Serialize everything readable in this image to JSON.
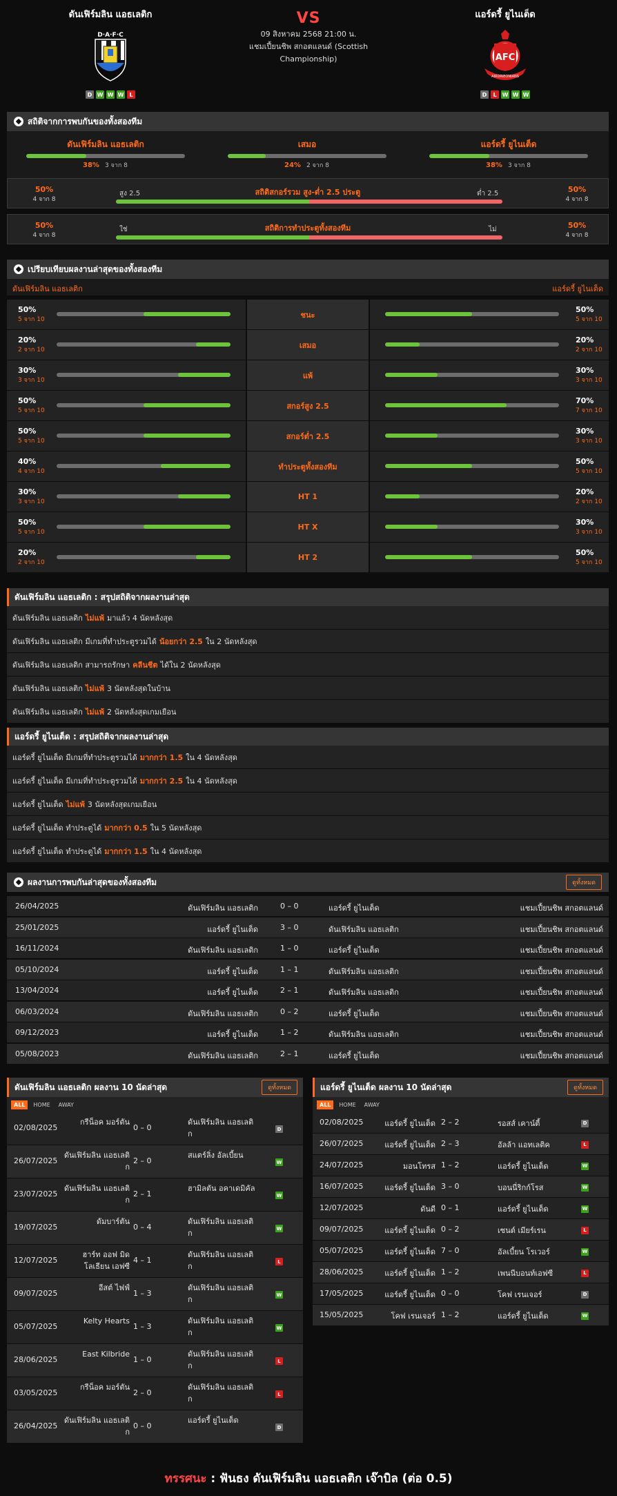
{
  "header": {
    "home": {
      "name": "ดันเฟิร์มลิน แอธเลติก",
      "logo_text": "D·A·F·C",
      "form": [
        "D",
        "W",
        "W",
        "W",
        "L"
      ]
    },
    "away": {
      "name": "แอร์ดรี้ ยูไนเต็ด",
      "logo_text": "AFC",
      "logo_ribbon": "AIRDRIEONIANS",
      "form": [
        "D",
        "L",
        "W",
        "W",
        "W"
      ]
    },
    "vs": "VS",
    "date": "09 สิงหาคม 2568 21:00 น.",
    "competition": "แชมเปี้ยนชิพ สกอตแลนด์ (Scottish Championship)"
  },
  "h2h_stats": {
    "title": "สถิติจากการพบกันของทั้งสองทีม",
    "cols": [
      {
        "label": "ดันเฟิร์มลิน แอธเลติก",
        "pct": "38%",
        "detail": "3 จาก 8",
        "value": 0.38
      },
      {
        "label": "เสมอ",
        "pct": "24%",
        "detail": "2 จาก 8",
        "value": 0.24
      },
      {
        "label": "แอร์ดรี้ ยูไนเต็ด",
        "pct": "38%",
        "detail": "3 จาก 8",
        "value": 0.38
      }
    ],
    "over_under": {
      "title": "สถิติสกอร์รวม สูง-ต่ำ 2.5 ประตู",
      "left_pct": "50%",
      "left_detail": "4 จาก 8",
      "left_label": "สูง 2.5",
      "right_label": "ต่ำ 2.5",
      "right_pct": "50%",
      "right_detail": "4 จาก 8",
      "value": 0.5
    },
    "btts": {
      "title": "สถิติการทำประตูทั้งสองทีม",
      "left_pct": "50%",
      "left_detail": "4 จาก 8",
      "left_label": "ใช่",
      "right_label": "ไม่",
      "right_pct": "50%",
      "right_detail": "4 จาก 8",
      "value": 0.5
    }
  },
  "recent_compare": {
    "title": "เปรียบเทียบผลงานล่าสุดของทั้งสองทีม",
    "home_label": "ดันเฟิร์มลิน แอธเลติก",
    "away_label": "แอร์ดรี้ ยูไนเต็ด",
    "rows": [
      {
        "label": "ชนะ",
        "home_pct": "50%",
        "home_detail": "5 จาก 10",
        "home_value": 0.5,
        "away_pct": "50%",
        "away_detail": "5 จาก 10",
        "away_value": 0.5
      },
      {
        "label": "เสมอ",
        "home_pct": "20%",
        "home_detail": "2 จาก 10",
        "home_value": 0.2,
        "away_pct": "20%",
        "away_detail": "2 จาก 10",
        "away_value": 0.2
      },
      {
        "label": "แพ้",
        "home_pct": "30%",
        "home_detail": "3 จาก 10",
        "home_value": 0.3,
        "away_pct": "30%",
        "away_detail": "3 จาก 10",
        "away_value": 0.3
      },
      {
        "label": "สกอร์สูง 2.5",
        "home_pct": "50%",
        "home_detail": "5 จาก 10",
        "home_value": 0.5,
        "away_pct": "70%",
        "away_detail": "7 จาก 10",
        "away_value": 0.7
      },
      {
        "label": "สกอร์ต่ำ 2.5",
        "home_pct": "50%",
        "home_detail": "5 จาก 10",
        "home_value": 0.5,
        "away_pct": "30%",
        "away_detail": "3 จาก 10",
        "away_value": 0.3
      },
      {
        "label": "ทำประตูทั้งสองทีม",
        "home_pct": "40%",
        "home_detail": "4 จาก 10",
        "home_value": 0.4,
        "away_pct": "50%",
        "away_detail": "5 จาก 10",
        "away_value": 0.5
      },
      {
        "label": "HT 1",
        "home_pct": "30%",
        "home_detail": "3 จาก 10",
        "home_value": 0.3,
        "away_pct": "20%",
        "away_detail": "2 จาก 10",
        "away_value": 0.2
      },
      {
        "label": "HT X",
        "home_pct": "50%",
        "home_detail": "5 จาก 10",
        "home_value": 0.5,
        "away_pct": "30%",
        "away_detail": "3 จาก 10",
        "away_value": 0.3
      },
      {
        "label": "HT 2",
        "home_pct": "20%",
        "home_detail": "2 จาก 10",
        "home_value": 0.2,
        "away_pct": "50%",
        "away_detail": "5 จาก 10",
        "away_value": 0.5
      }
    ]
  },
  "home_summary": {
    "title": "ดันเฟิร์มลิน แอธเลติก : สรุปสถิติจากผลงานล่าสุด",
    "rows": [
      {
        "pre": "ดันเฟิร์มลิน แอธเลติก",
        "hl": "ไม่แพ้",
        "post": "มาแล้ว 4 นัดหลังสุด"
      },
      {
        "pre": "ดันเฟิร์มลิน แอธเลติก มีเกมที่ทำประตูรวมได้",
        "hl": "น้อยกว่า 2.5",
        "post": "ใน 2 นัดหลังสุด"
      },
      {
        "pre": "ดันเฟิร์มลิน แอธเลติก สามารถรักษา",
        "hl": "คลีนชีต",
        "post": "ได้ใน 2 นัดหลังสุด"
      },
      {
        "pre": "ดันเฟิร์มลิน แอธเลติก",
        "hl": "ไม่แพ้",
        "post": "3 นัดหลังสุดในบ้าน"
      },
      {
        "pre": "ดันเฟิร์มลิน แอธเลติก",
        "hl": "ไม่แพ้",
        "post": "2 นัดหลังสุดเกมเยือน"
      }
    ]
  },
  "away_summary": {
    "title": "แอร์ดรี้ ยูไนเต็ด : สรุปสถิติจากผลงานล่าสุด",
    "rows": [
      {
        "pre": "แอร์ดรี้ ยูไนเต็ด มีเกมที่ทำประตูรวมได้",
        "hl": "มากกว่า 1.5",
        "post": "ใน 4 นัดหลังสุด"
      },
      {
        "pre": "แอร์ดรี้ ยูไนเต็ด มีเกมที่ทำประตูรวมได้",
        "hl": "มากกว่า 2.5",
        "post": "ใน 4 นัดหลังสุด"
      },
      {
        "pre": "แอร์ดรี้ ยูไนเต็ด",
        "hl": "ไม่แพ้",
        "post": "3 นัดหลังสุดเกมเยือน"
      },
      {
        "pre": "แอร์ดรี้ ยูไนเต็ด ทำประตูได้",
        "hl": "มากกว่า 0.5",
        "post": "ใน 5 นัดหลังสุด"
      },
      {
        "pre": "แอร์ดรี้ ยูไนเต็ด ทำประตูได้",
        "hl": "มากกว่า 1.5",
        "post": "ใน 4 นัดหลังสุด"
      }
    ]
  },
  "h2h_matches": {
    "title": "ผลงานการพบกันล่าสุดของทั้งสองทีม",
    "see_all": "ดูทั้งหมด",
    "rows": [
      {
        "date": "26/04/2025",
        "home": "ดันเฟิร์มลิน แอธเลติก",
        "score": "0 – 0",
        "away": "แอร์ดรี้ ยูไนเต็ด",
        "league": "แชมเปี้ยนชิพ สกอตแลนด์"
      },
      {
        "date": "25/01/2025",
        "home": "แอร์ดรี้ ยูไนเต็ด",
        "score": "3 – 0",
        "away": "ดันเฟิร์มลิน แอธเลติก",
        "league": "แชมเปี้ยนชิพ สกอตแลนด์"
      },
      {
        "date": "16/11/2024",
        "home": "ดันเฟิร์มลิน แอธเลติก",
        "score": "1 – 0",
        "away": "แอร์ดรี้ ยูไนเต็ด",
        "league": "แชมเปี้ยนชิพ สกอตแลนด์"
      },
      {
        "date": "05/10/2024",
        "home": "แอร์ดรี้ ยูไนเต็ด",
        "score": "1 – 1",
        "away": "ดันเฟิร์มลิน แอธเลติก",
        "league": "แชมเปี้ยนชิพ สกอตแลนด์"
      },
      {
        "date": "13/04/2024",
        "home": "แอร์ดรี้ ยูไนเต็ด",
        "score": "2 – 1",
        "away": "ดันเฟิร์มลิน แอธเลติก",
        "league": "แชมเปี้ยนชิพ สกอตแลนด์"
      },
      {
        "date": "06/03/2024",
        "home": "ดันเฟิร์มลิน แอธเลติก",
        "score": "0 – 2",
        "away": "แอร์ดรี้ ยูไนเต็ด",
        "league": "แชมเปี้ยนชิพ สกอตแลนด์"
      },
      {
        "date": "09/12/2023",
        "home": "แอร์ดรี้ ยูไนเต็ด",
        "score": "1 – 2",
        "away": "ดันเฟิร์มลิน แอธเลติก",
        "league": "แชมเปี้ยนชิพ สกอตแลนด์"
      },
      {
        "date": "05/08/2023",
        "home": "ดันเฟิร์มลิน แอธเลติก",
        "score": "2 – 1",
        "away": "แอร์ดรี้ ยูไนเต็ด",
        "league": "แชมเปี้ยนชิพ สกอตแลนด์"
      }
    ]
  },
  "home_last10": {
    "title": "ดันเฟิร์มลิน แอธเลติก ผลงาน 10 นัดล่าสุด",
    "see_all": "ดูทั้งหมด",
    "tabs": [
      "ALL",
      "HOME",
      "AWAY"
    ],
    "rows": [
      {
        "date": "02/08/2025",
        "home": "กรีน็อค มอร์ตัน",
        "score": "0 – 0",
        "away": "ดันเฟิร์มลิน แอธเลติก",
        "res": "D"
      },
      {
        "date": "26/07/2025",
        "home": "ดันเฟิร์มลิน แอธเลติก",
        "score": "2 – 0",
        "away": "สแตร์ลิ่ง อัลเบี้ยน",
        "res": "W"
      },
      {
        "date": "23/07/2025",
        "home": "ดันเฟิร์มลิน แอธเลติก",
        "score": "2 – 1",
        "away": "ฮามิลตัน อคาเดมิคัล",
        "res": "W"
      },
      {
        "date": "19/07/2025",
        "home": "ดัมบาร์ตัน",
        "score": "0 – 4",
        "away": "ดันเฟิร์มลิน แอธเลติก",
        "res": "W"
      },
      {
        "date": "12/07/2025",
        "home": "ฮาร์ท ออฟ มิดโลเธียน เอฟซี",
        "score": "4 – 1",
        "away": "ดันเฟิร์มลิน แอธเลติก",
        "res": "L"
      },
      {
        "date": "09/07/2025",
        "home": "อีสต์ ไฟฟ์",
        "score": "1 – 3",
        "away": "ดันเฟิร์มลิน แอธเลติก",
        "res": "W"
      },
      {
        "date": "05/07/2025",
        "home": "Kelty Hearts",
        "score": "1 – 3",
        "away": "ดันเฟิร์มลิน แอธเลติก",
        "res": "W"
      },
      {
        "date": "28/06/2025",
        "home": "East Kilbride",
        "score": "1 – 0",
        "away": "ดันเฟิร์มลิน แอธเลติก",
        "res": "L"
      },
      {
        "date": "03/05/2025",
        "home": "กรีน็อค มอร์ตัน",
        "score": "2 – 0",
        "away": "ดันเฟิร์มลิน แอธเลติก",
        "res": "L"
      },
      {
        "date": "26/04/2025",
        "home": "ดันเฟิร์มลิน แอธเลติก",
        "score": "0 – 0",
        "away": "แอร์ดรี้ ยูไนเต็ด",
        "res": "D"
      }
    ]
  },
  "away_last10": {
    "title": "แอร์ดรี้ ยูไนเต็ด ผลงาน 10 นัดล่าสุด",
    "see_all": "ดูทั้งหมด",
    "tabs": [
      "ALL",
      "HOME",
      "AWAY"
    ],
    "rows": [
      {
        "date": "02/08/2025",
        "home": "แอร์ดรี้ ยูไนเต็ด",
        "score": "2 – 2",
        "away": "รอสส์ เคาน์ตี้",
        "res": "D"
      },
      {
        "date": "26/07/2025",
        "home": "แอร์ดรี้ ยูไนเต็ด",
        "score": "2 – 3",
        "away": "อัลล้า แอทเลติค",
        "res": "L"
      },
      {
        "date": "24/07/2025",
        "home": "มอนโทรส",
        "score": "1 – 2",
        "away": "แอร์ดรี้ ยูไนเต็ด",
        "res": "W"
      },
      {
        "date": "16/07/2025",
        "home": "แอร์ดรี้ ยูไนเต็ด",
        "score": "3 – 0",
        "away": "บอนนี่ริกก์โรส",
        "res": "W"
      },
      {
        "date": "12/07/2025",
        "home": "ดันดี",
        "score": "0 – 1",
        "away": "แอร์ดรี้ ยูไนเต็ด",
        "res": "W"
      },
      {
        "date": "09/07/2025",
        "home": "แอร์ดรี้ ยูไนเต็ด",
        "score": "0 – 2",
        "away": "เซนต์ เมียร์เรน",
        "res": "L"
      },
      {
        "date": "05/07/2025",
        "home": "แอร์ดรี้ ยูไนเต็ด",
        "score": "7 – 0",
        "away": "อัลเบี้ยน โรเวอร์",
        "res": "W"
      },
      {
        "date": "28/06/2025",
        "home": "แอร์ดรี้ ยูไนเต็ด",
        "score": "1 – 2",
        "away": "เพนนีบอนท์เอฟซี",
        "res": "L"
      },
      {
        "date": "17/05/2025",
        "home": "แอร์ดรี้ ยูไนเต็ด",
        "score": "0 – 0",
        "away": "โคฟ เรนเจอร์",
        "res": "D"
      },
      {
        "date": "15/05/2025",
        "home": "โคฟ เรนเจอร์",
        "score": "1 – 2",
        "away": "แอร์ดรี้ ยูไนเต็ด",
        "res": "W"
      }
    ]
  },
  "prediction": {
    "label": "ทรรศนะ",
    "sep": ":",
    "text": "ฟันธง ดันเฟิร์มลิน แอธเลติก เจ๊าบิล (ต่อ 0.5)"
  },
  "colors": {
    "accent": "#ff6b1a",
    "win": "#3ca21e",
    "draw": "#6e6e6e",
    "loss": "#d62020",
    "bar_green": "#6dc33c",
    "bar_red": "#f06565"
  }
}
